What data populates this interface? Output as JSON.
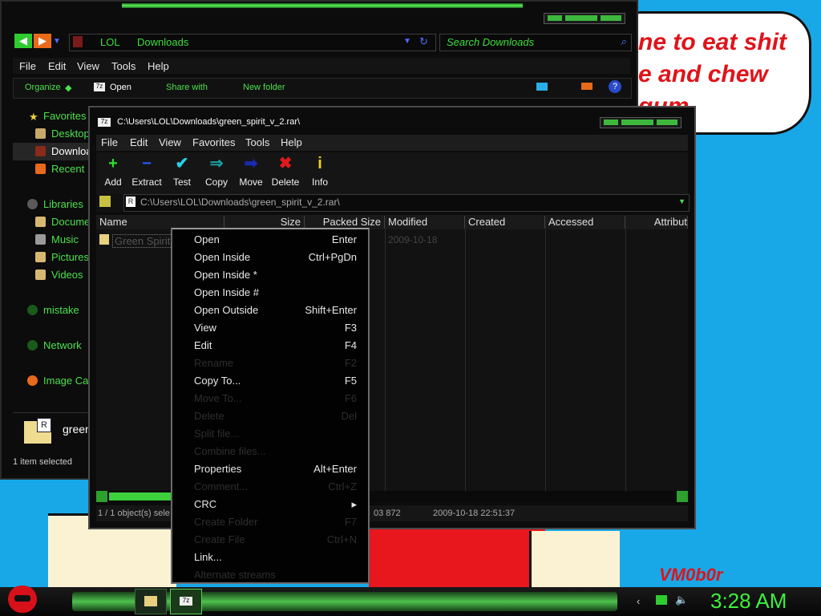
{
  "wallpaper": {
    "bubble_lines": [
      "ne to eat shit",
      "e and chew",
      "gum"
    ],
    "signature": "VM0b0r"
  },
  "explorer": {
    "breadcrumb": [
      "LOL",
      "Downloads"
    ],
    "search_placeholder": "Search Downloads",
    "menu": [
      "File",
      "Edit",
      "View",
      "Tools",
      "Help"
    ],
    "commands": {
      "organize": "Organize",
      "open": "Open",
      "share": "Share with",
      "new_folder": "New folder"
    },
    "sidebar": [
      {
        "label": "Favorites",
        "icon": "star-icon"
      },
      {
        "label": "Desktop",
        "icon": "desktop-icon"
      },
      {
        "label": "Downloa",
        "icon": "downloads-icon"
      },
      {
        "label": "Recent",
        "icon": "recent-icon"
      },
      {
        "label": "Libraries",
        "icon": "libraries-icon"
      },
      {
        "label": "Docume",
        "icon": "documents-icon"
      },
      {
        "label": "Music",
        "icon": "music-icon"
      },
      {
        "label": "Pictures",
        "icon": "pictures-icon"
      },
      {
        "label": "Videos",
        "icon": "videos-icon"
      },
      {
        "label": "mistake",
        "icon": "homegroup-icon"
      },
      {
        "label": "Network",
        "icon": "network-icon"
      },
      {
        "label": "Image Ca",
        "icon": "image-capture-icon"
      }
    ],
    "details_name": "green",
    "status": "1 item selected"
  },
  "sevenzip": {
    "title": "C:\\Users\\LOL\\Downloads\\green_spirit_v_2.rar\\",
    "menu": [
      "File",
      "Edit",
      "View",
      "Favorites",
      "Tools",
      "Help"
    ],
    "toolbar": [
      {
        "label": "Add",
        "icon": "add-icon",
        "glyph": "+",
        "color": "#2ee02e"
      },
      {
        "label": "Extract",
        "icon": "extract-icon",
        "glyph": "−",
        "color": "#2a5bff"
      },
      {
        "label": "Test",
        "icon": "test-icon",
        "glyph": "✔",
        "color": "#2ad0e8"
      },
      {
        "label": "Copy",
        "icon": "copy-icon",
        "glyph": "⇒",
        "color": "#1aa0a0"
      },
      {
        "label": "Move",
        "icon": "move-icon",
        "glyph": "➡",
        "color": "#1a2ab0"
      },
      {
        "label": "Delete",
        "icon": "delete-icon",
        "glyph": "✖",
        "color": "#e01a1a"
      },
      {
        "label": "Info",
        "icon": "info-icon",
        "glyph": "i",
        "color": "#f0d020"
      }
    ],
    "address": "C:\\Users\\LOL\\Downloads\\green_spirit_v_2.rar\\",
    "columns": [
      "Name",
      "Size",
      "Packed Size",
      "Modified",
      "Created",
      "Accessed",
      "Attribut"
    ],
    "row": {
      "name": "Green Spirit",
      "modified": "2009-10-18"
    },
    "status": {
      "selected": "1 / 1 object(s) sele",
      "size": "03 872",
      "modified": "2009-10-18 22:51:37"
    }
  },
  "context_menu": [
    {
      "label": "Open",
      "shortcut": "Enter",
      "enabled": true
    },
    {
      "label": "Open Inside",
      "shortcut": "Ctrl+PgDn",
      "enabled": true
    },
    {
      "label": "Open Inside *",
      "shortcut": "",
      "enabled": true
    },
    {
      "label": "Open Inside #",
      "shortcut": "",
      "enabled": true
    },
    {
      "label": "Open Outside",
      "shortcut": "Shift+Enter",
      "enabled": true
    },
    {
      "label": "View",
      "shortcut": "F3",
      "enabled": true
    },
    {
      "label": "Edit",
      "shortcut": "F4",
      "enabled": true
    },
    {
      "label": "Rename",
      "shortcut": "F2",
      "enabled": false
    },
    {
      "label": "Copy To...",
      "shortcut": "F5",
      "enabled": true
    },
    {
      "label": "Move To...",
      "shortcut": "F6",
      "enabled": false
    },
    {
      "label": "Delete",
      "shortcut": "Del",
      "enabled": false
    },
    {
      "label": "Split file...",
      "shortcut": "",
      "enabled": false
    },
    {
      "label": "Combine files...",
      "shortcut": "",
      "enabled": false
    },
    {
      "label": "Properties",
      "shortcut": "Alt+Enter",
      "enabled": true
    },
    {
      "label": "Comment...",
      "shortcut": "Ctrl+Z",
      "enabled": false
    },
    {
      "label": "CRC",
      "shortcut": "▸",
      "enabled": true
    },
    {
      "label": "Create Folder",
      "shortcut": "F7",
      "enabled": false
    },
    {
      "label": "Create File",
      "shortcut": "Ctrl+N",
      "enabled": false
    },
    {
      "label": "Link...",
      "shortcut": "",
      "enabled": true
    },
    {
      "label": "Alternate streams",
      "shortcut": "",
      "enabled": false
    }
  ],
  "taskbar": {
    "clock": "3:28 AM"
  }
}
